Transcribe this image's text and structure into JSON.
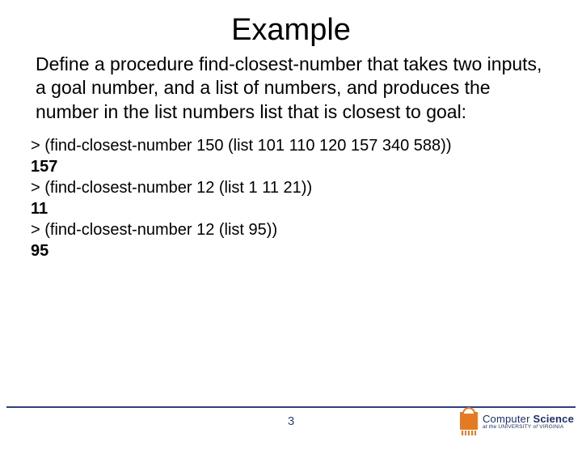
{
  "title": "Example",
  "body": "Define a procedure find-closest-number that takes two inputs, a goal number, and a list of numbers, and produces the number in the list numbers list that is closest to goal:",
  "code": {
    "l1": "> (find-closest-number 150 (list 101 110 120 157 340 588))",
    "r1": "157",
    "l2": "> (find-closest-number 12 (list 1 11 21))",
    "r2": "11",
    "l3": "> (find-closest-number 12 (list 95))",
    "r3": "95"
  },
  "page": "3",
  "logo": {
    "main_a": "Computer ",
    "main_b": "Science",
    "sub_a": "at the ",
    "sub_b": "UNIVERSITY",
    "sub_c": " of ",
    "sub_d": "VIRGINIA"
  }
}
